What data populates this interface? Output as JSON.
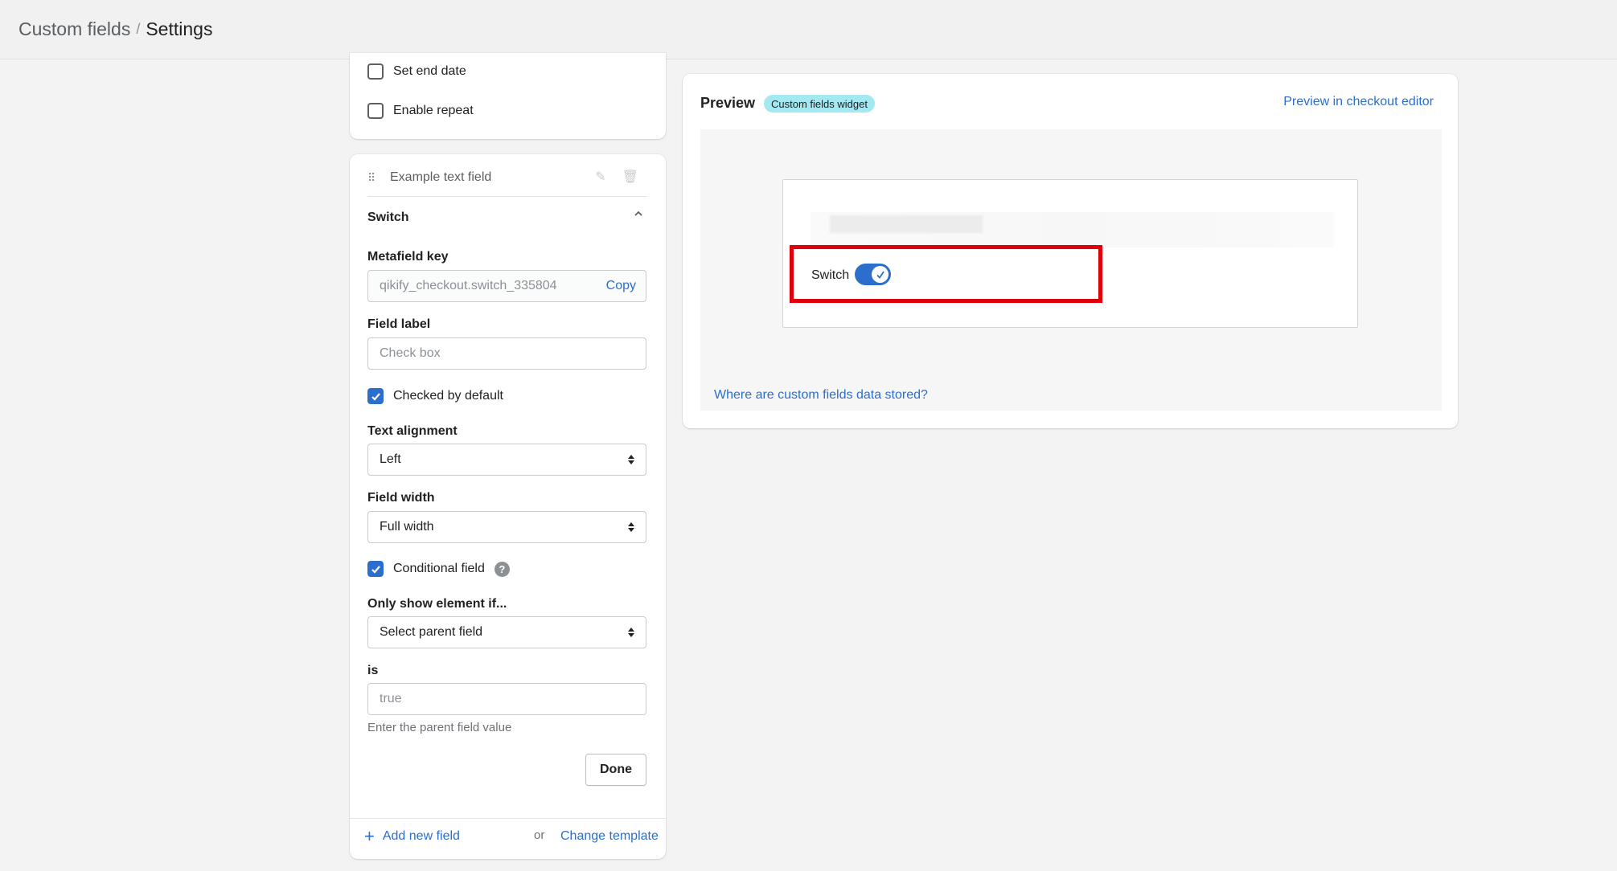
{
  "breadcrumb": {
    "parent": "Custom fields",
    "current": "Settings"
  },
  "date_options": {
    "set_end_date": {
      "label": "Set end date",
      "checked": false
    },
    "enable_repeat": {
      "label": "Enable repeat",
      "checked": false
    }
  },
  "field_editor": {
    "field_name": "Example text field",
    "section_title": "Switch",
    "metafield_key": {
      "label": "Metafield key",
      "value": "qikify_checkout.switch_335804",
      "copy_label": "Copy"
    },
    "field_label": {
      "label": "Field label",
      "placeholder": "Check box"
    },
    "checked_by_default": {
      "label": "Checked by default",
      "checked": true
    },
    "text_alignment": {
      "label": "Text alignment",
      "value": "Left"
    },
    "field_width": {
      "label": "Field width",
      "value": "Full width"
    },
    "conditional_field": {
      "label": "Conditional field",
      "checked": true,
      "help_glyph": "?"
    },
    "only_show": {
      "label": "Only show element if...",
      "value": "Select parent field"
    },
    "is_field": {
      "label": "is",
      "placeholder": "true",
      "help_text": "Enter the parent field value"
    },
    "done_label": "Done"
  },
  "footer": {
    "add_new_field": "Add new field",
    "or": "or",
    "change_template": "Change template"
  },
  "preview": {
    "title": "Preview",
    "badge": "Custom fields widget",
    "editor_link": "Preview in checkout editor",
    "switch_label": "Switch",
    "switch_on": true,
    "data_link": "Where are custom fields data stored?"
  },
  "colors": {
    "accent": "#2c6ecb",
    "badge": "#a4e8f2",
    "highlight": "#e0000b"
  }
}
